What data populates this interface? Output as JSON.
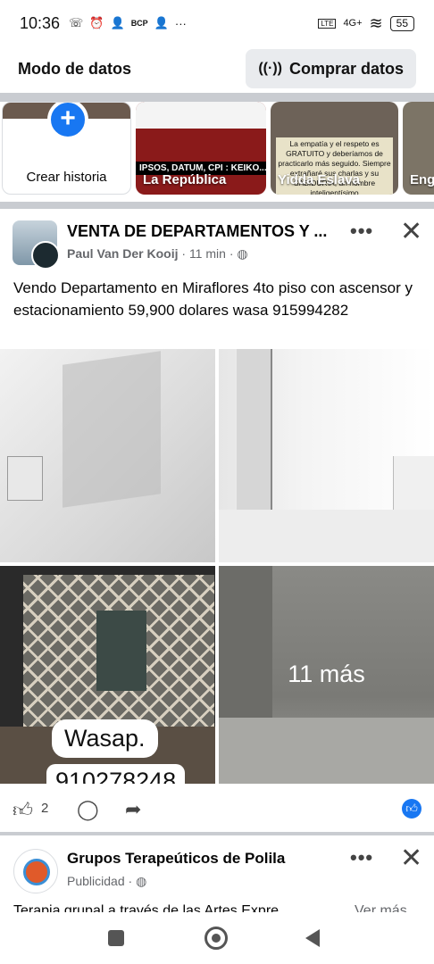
{
  "status_bar": {
    "time": "10:36",
    "carrier_badge": "BCP",
    "network": "4G+",
    "battery": "55"
  },
  "data_mode": {
    "title": "Modo de datos",
    "buy_button": "Comprar datos"
  },
  "stories": {
    "create_label": "Crear historia",
    "items": [
      {
        "name": "La República",
        "overlay": "IPSOS, DATUM, CPI : KEIKO... A SEGU"
      },
      {
        "name": "Yidda Eslava",
        "text": "La empatía y el respeto es GRATUITO y deberíamos de practicarlo más seguido. Siempre extrañaré sus charlas y su SABIDURÍA, un hombre inteligentísimo"
      },
      {
        "name": "Eng"
      }
    ]
  },
  "post": {
    "group_title": "VENTA DE DEPARTAMENTOS Y ...",
    "author": "Paul Van Der Kooij",
    "time": "11 min",
    "body": "Vendo Departamento en Miraflores 4to piso con ascensor y estacionamiento  59,900 dolares wasa 915994282",
    "photo_caption": "Wasap.",
    "photo_number": "910278248",
    "more_photos": "11 más",
    "like_count": "2"
  },
  "ad": {
    "title": "Grupos Terapeúticos de Polila",
    "meta": "Publicidad",
    "text": "Terapia grupal a través de las Artes Expre",
    "see_more": "Ver más"
  },
  "icons": {
    "more": "more-dots-icon",
    "close": "close-icon",
    "like": "like-icon",
    "comment": "comment-icon",
    "share": "share-icon"
  },
  "colors": {
    "accent": "#1877f2",
    "divider": "#c9ccd1",
    "meta_text": "#65676b"
  }
}
